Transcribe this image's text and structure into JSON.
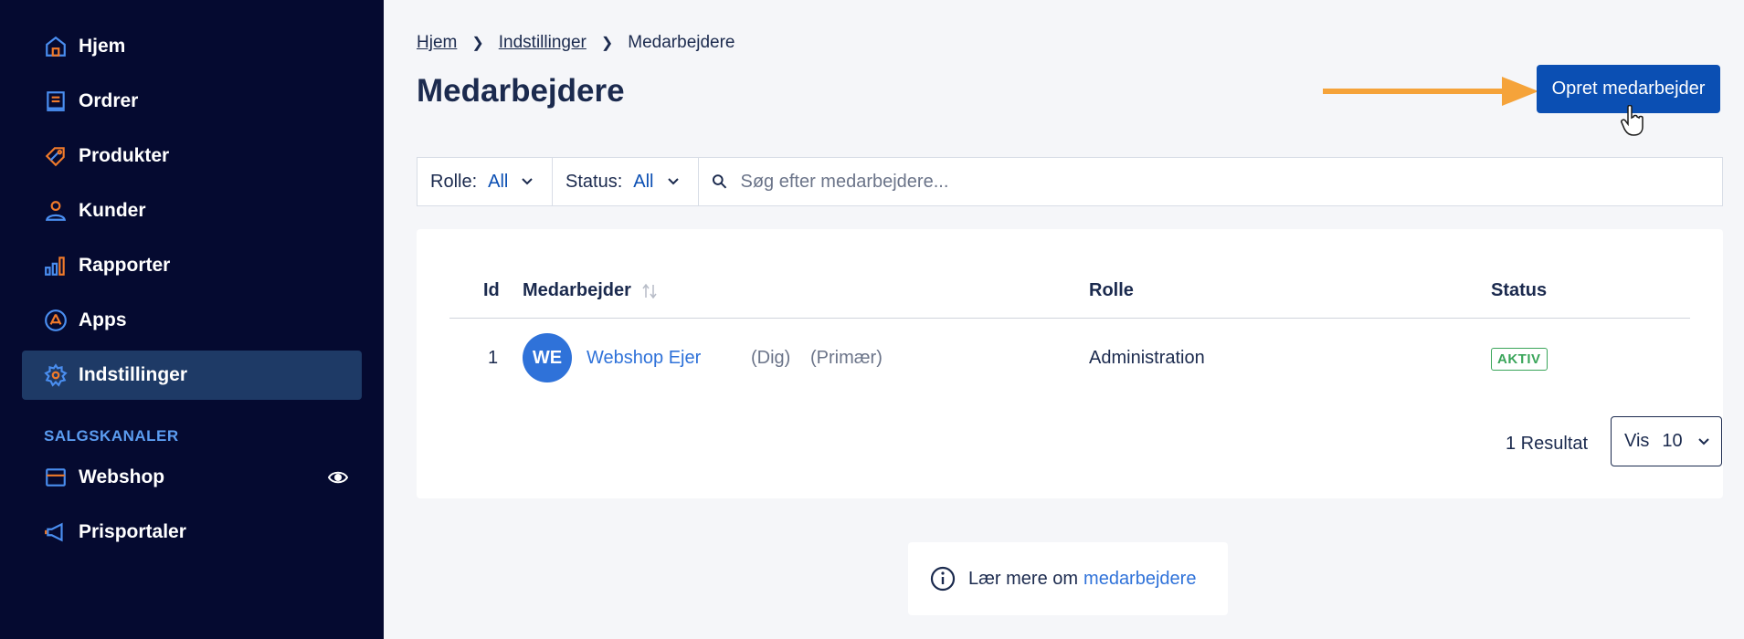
{
  "sidebar": {
    "items": [
      {
        "label": "Hjem",
        "icon": "home-icon"
      },
      {
        "label": "Ordrer",
        "icon": "orders-icon"
      },
      {
        "label": "Produkter",
        "icon": "tag-icon"
      },
      {
        "label": "Kunder",
        "icon": "user-icon"
      },
      {
        "label": "Rapporter",
        "icon": "chart-icon"
      },
      {
        "label": "Apps",
        "icon": "apps-icon"
      },
      {
        "label": "Indstillinger",
        "icon": "gear-icon",
        "active": true
      }
    ],
    "section_label": "SALGSKANALER",
    "channels": [
      {
        "label": "Webshop",
        "icon": "store-icon"
      },
      {
        "label": "Prisportaler",
        "icon": "megaphone-icon"
      }
    ]
  },
  "breadcrumb": {
    "items": [
      "Hjem",
      "Indstillinger"
    ],
    "current": "Medarbejdere"
  },
  "page_title": "Medarbejdere",
  "create_button": "Opret medarbejder",
  "filters": {
    "role_label": "Rolle:",
    "role_value": "All",
    "status_label": "Status:",
    "status_value": "All",
    "search_placeholder": "Søg efter medarbejdere..."
  },
  "table": {
    "headers": {
      "id": "Id",
      "employee": "Medarbejder",
      "role": "Rolle",
      "status": "Status"
    },
    "rows": [
      {
        "id": "1",
        "initials": "WE",
        "name": "Webshop Ejer",
        "tag1": "(Dig)",
        "tag2": "(Primær)",
        "role": "Administration",
        "status": "AKTIV"
      }
    ],
    "result_count": "1 Resultat",
    "page_size_label": "Vis",
    "page_size_value": "10"
  },
  "learn_more": {
    "text": "Lær mere om",
    "link": "medarbejdere"
  },
  "colors": {
    "sidebar_bg": "#050a30",
    "sidebar_active": "#1e3a66",
    "primary": "#0b4fb3",
    "link": "#2f72d9",
    "success": "#3aa55a",
    "annotation_arrow": "#f5a33a"
  }
}
